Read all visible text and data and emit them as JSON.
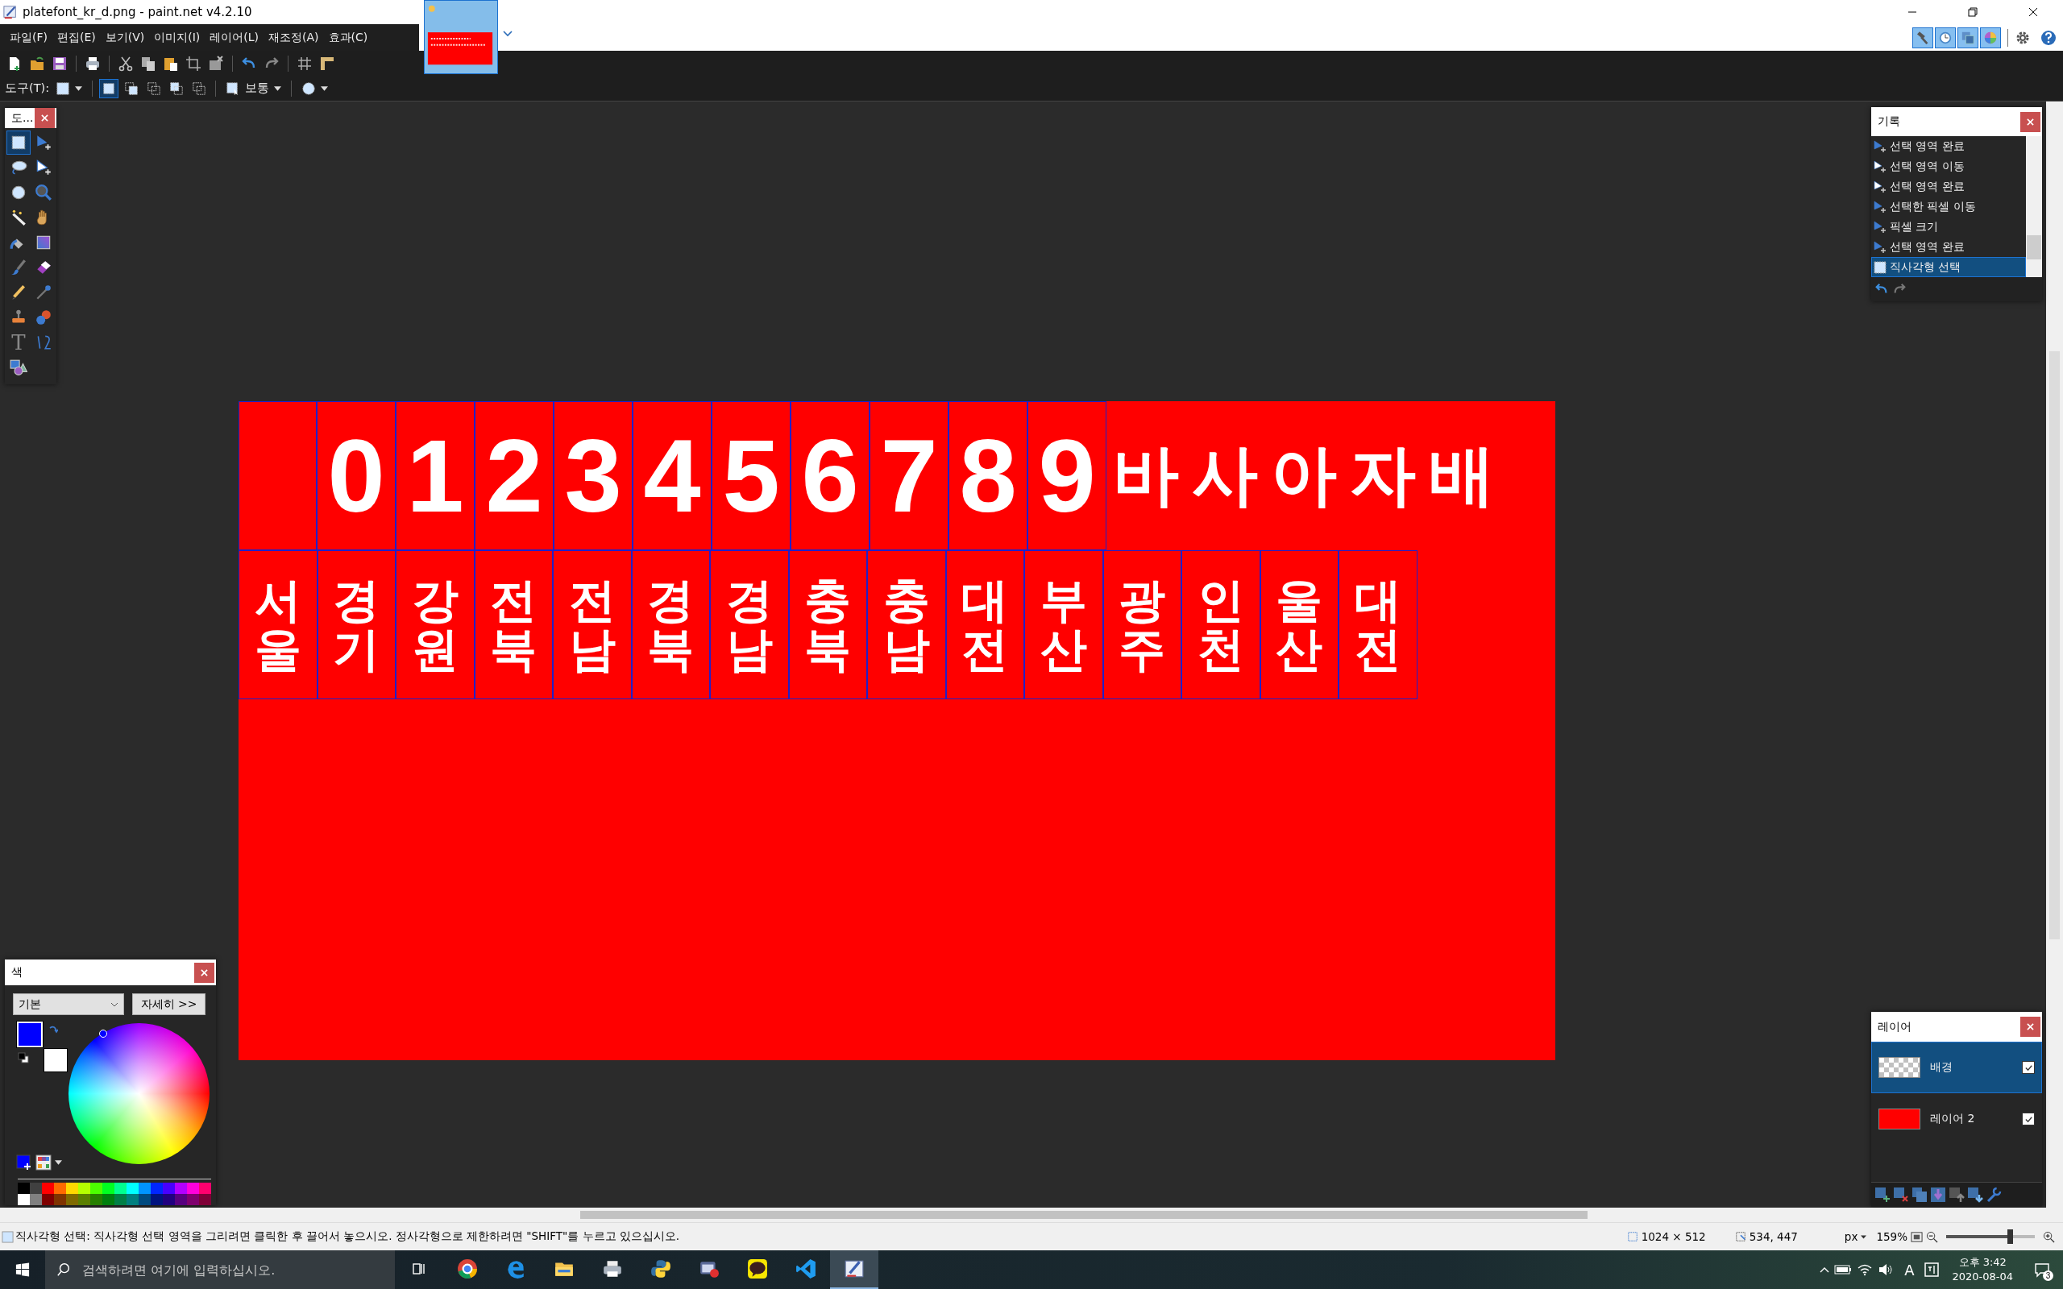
{
  "window": {
    "title": "platefont_kr_d.png - paint.net v4.2.10"
  },
  "menu": [
    "파일(F)",
    "편집(E)",
    "보기(V)",
    "이미지(I)",
    "레이어(L)",
    "재조정(A)",
    "효과(C)"
  ],
  "panel_toggles": [
    {
      "kind": "tools",
      "on": true
    },
    {
      "kind": "history",
      "on": true
    },
    {
      "kind": "layers",
      "on": true
    },
    {
      "kind": "colors",
      "on": true
    }
  ],
  "tool_options": {
    "label": "도구(T):",
    "selection_modes": [
      {
        "selected": true
      },
      {
        "selected": false
      },
      {
        "selected": false
      },
      {
        "selected": false
      },
      {
        "selected": false
      }
    ],
    "quality": "보통"
  },
  "tools_panel": {
    "title": "도...",
    "tools": [
      {
        "kind": "rect-select",
        "selected": true
      },
      {
        "kind": "move-pixels",
        "selected": false
      },
      {
        "kind": "lasso",
        "selected": false
      },
      {
        "kind": "move-selection",
        "selected": false
      },
      {
        "kind": "ellipse-select",
        "selected": false
      },
      {
        "kind": "zoom",
        "selected": false
      },
      {
        "kind": "magic-wand",
        "selected": false
      },
      {
        "kind": "pan",
        "selected": false
      },
      {
        "kind": "bucket",
        "selected": false
      },
      {
        "kind": "gradient",
        "selected": false
      },
      {
        "kind": "brush",
        "selected": false
      },
      {
        "kind": "eraser",
        "selected": false
      },
      {
        "kind": "pencil",
        "selected": false
      },
      {
        "kind": "picker",
        "selected": false
      },
      {
        "kind": "stamp",
        "selected": false
      },
      {
        "kind": "recolor",
        "selected": false
      },
      {
        "kind": "text",
        "glyph": "T",
        "selected": false
      },
      {
        "kind": "line",
        "selected": false
      },
      {
        "kind": "shapes",
        "selected": false
      }
    ]
  },
  "history_panel": {
    "title": "기록",
    "items": [
      {
        "label": "선택 영역 완료",
        "kind": "move",
        "selected": false
      },
      {
        "label": "선택 영역 이동",
        "kind": "move-white",
        "selected": false
      },
      {
        "label": "선택 영역 완료",
        "kind": "move-white",
        "selected": false
      },
      {
        "label": "선택한 픽셀 이동",
        "kind": "move",
        "selected": false
      },
      {
        "label": "픽셀 크기",
        "kind": "move",
        "selected": false
      },
      {
        "label": "선택 영역 완료",
        "kind": "move",
        "selected": false
      },
      {
        "label": "직사각형 선택",
        "kind": "rect",
        "selected": true
      }
    ]
  },
  "image": {
    "digits": [
      "0",
      "1",
      "2",
      "3",
      "4",
      "5",
      "6",
      "7",
      "8",
      "9"
    ],
    "letters": [
      "바",
      "사",
      "아",
      "자",
      "배"
    ],
    "regions": [
      "서울",
      "경기",
      "강원",
      "전북",
      "전남",
      "경북",
      "경남",
      "충북",
      "충남",
      "대전",
      "부산",
      "광주",
      "인천",
      "울산",
      "대전"
    ]
  },
  "color_panel": {
    "title": "색",
    "palette_select": "기본",
    "more_button": "자세히 >>",
    "swatches": [
      {
        "kind": "primary",
        "color": "#0000ff"
      },
      {
        "kind": "secondary",
        "color": "#ffffff"
      }
    ],
    "palette": [
      {
        "color": "#000000"
      },
      {
        "color": "#404040"
      },
      {
        "color": "#ff0000"
      },
      {
        "color": "#ff6a00"
      },
      {
        "color": "#ffd800"
      },
      {
        "color": "#b6ff00"
      },
      {
        "color": "#4cff00"
      },
      {
        "color": "#00ff21"
      },
      {
        "color": "#00ff90"
      },
      {
        "color": "#00ffff"
      },
      {
        "color": "#0094ff"
      },
      {
        "color": "#0026ff"
      },
      {
        "color": "#4800ff"
      },
      {
        "color": "#b200ff"
      },
      {
        "color": "#ff00dc"
      },
      {
        "color": "#ff006e"
      },
      {
        "color": "#ffffff"
      },
      {
        "color": "#808080"
      },
      {
        "color": "#7f0000"
      },
      {
        "color": "#7f3300"
      },
      {
        "color": "#7f6a00"
      },
      {
        "color": "#5b7f00"
      },
      {
        "color": "#267f00"
      },
      {
        "color": "#007f0e"
      },
      {
        "color": "#007f46"
      },
      {
        "color": "#007f7f"
      },
      {
        "color": "#004a7f"
      },
      {
        "color": "#00137f"
      },
      {
        "color": "#21007f"
      },
      {
        "color": "#57007f"
      },
      {
        "color": "#7f006e"
      },
      {
        "color": "#7f0037"
      }
    ]
  },
  "layers_panel": {
    "title": "레이어",
    "layers": [
      {
        "name": "배경",
        "kind": "transparent",
        "selected": true,
        "visible": true
      },
      {
        "name": "레이어 2",
        "kind": "red",
        "selected": false,
        "visible": true
      }
    ]
  },
  "status_bar": {
    "hint": "직사각형 선택: 직사각형 선택 영역을 그리려면 클릭한 후 끌어서 놓으시오. 정사각형으로 제한하려면 \"SHIFT\"를 누르고 있으십시오.",
    "image_size": "1024 × 512",
    "cursor": "534, 447",
    "unit": "px",
    "zoom": "159%",
    "zoom_slider": {
      "level": 0.72
    }
  },
  "taskbar": {
    "search_placeholder": "검색하려면 여기에 입력하십시오.",
    "apps": [
      {
        "kind": "chrome",
        "selected": false
      },
      {
        "kind": "edge",
        "selected": false
      },
      {
        "kind": "folder",
        "selected": false
      },
      {
        "kind": "printer",
        "selected": false
      },
      {
        "kind": "python",
        "selected": false
      },
      {
        "kind": "capture",
        "selected": false
      },
      {
        "kind": "chat",
        "selected": false
      },
      {
        "kind": "code",
        "selected": false
      },
      {
        "kind": "paint",
        "selected": true
      }
    ],
    "ime": "A",
    "time": "오후 3:42",
    "date": "2020-08-04",
    "notifications": "3"
  }
}
